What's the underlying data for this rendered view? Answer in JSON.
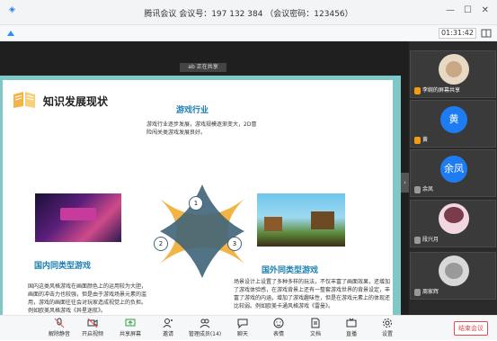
{
  "window": {
    "title": "腾讯会议 会议号：197 132 384 （会议密码：123456）"
  },
  "toolbar_top": {
    "timer": "01:31:42"
  },
  "shared": {
    "tag_label": "ab 正在共享",
    "slide": {
      "title": "知识发展现状",
      "industry": {
        "heading": "游戏行业",
        "text": "游戏行业逐步发展，游戏规模逐渐变大，2D冒险闯关类游戏发展良好。"
      },
      "domestic": {
        "heading": "国内同类型游戏",
        "text": "国内这类风格游戏在画面颜色上的运用较为大胆，画面的冲击力也较强，但是由于游戏场景元素的滥用，游戏的画面往往会对玩家造成视觉上的负担。例如欧美风格游戏《异星迷航》。"
      },
      "foreign": {
        "heading": "国外同类型游戏",
        "text": "场景设计上设置了多种多样的玩法，不仅丰富了画面效果，还增加了游戏体验感，在游戏背景上还有一整套游戏世界的背景设定，丰富了游戏的内涵，增加了游戏趣味性，但是在游戏元素上的体现还比较弱。例如欧美卡通风格游戏《雷曼》。"
      },
      "circle_numbers": [
        "1",
        "2",
        "3"
      ]
    }
  },
  "participants": [
    {
      "name": "李婉的屏幕共享",
      "avatar": "photo"
    },
    {
      "name": "黄",
      "avatar": "黄"
    },
    {
      "name": "余凤",
      "avatar": "余凤"
    },
    {
      "name": "段兴月",
      "avatar": "photo"
    },
    {
      "name": "周家辉",
      "avatar": "photo"
    }
  ],
  "bottom_toolbar": [
    {
      "label": "解除静音",
      "icon": "mic-muted-icon"
    },
    {
      "label": "开启视频",
      "icon": "camera-off-icon"
    },
    {
      "label": "共享屏幕",
      "icon": "share-screen-icon"
    },
    {
      "label": "邀请",
      "icon": "invite-icon"
    },
    {
      "label": "管理成员(14)",
      "icon": "members-icon"
    },
    {
      "label": "聊天",
      "icon": "chat-icon"
    },
    {
      "label": "表情",
      "icon": "emoji-icon"
    },
    {
      "label": "文档",
      "icon": "document-icon"
    },
    {
      "label": "直播",
      "icon": "live-icon"
    },
    {
      "label": "设置",
      "icon": "settings-icon"
    }
  ],
  "end_meeting_label": "结束会议",
  "colors": {
    "accent": "#1e7cf2",
    "end": "#e34d4d",
    "slide_border": "#7fc8c7",
    "diagram_orange": "#f2b545",
    "diagram_dark": "#3f6478"
  }
}
